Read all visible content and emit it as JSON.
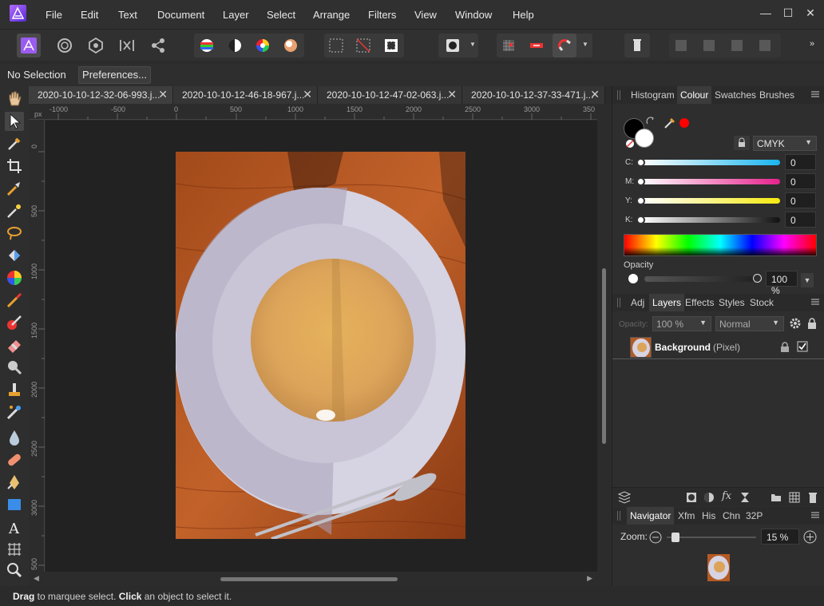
{
  "menu": {
    "items": [
      "File",
      "Edit",
      "Text",
      "Document",
      "Layer",
      "Select",
      "Arrange",
      "Filters",
      "View",
      "Window",
      "Help"
    ]
  },
  "window_controls": {
    "minimize": "—",
    "maximize": "☐",
    "close": "✕"
  },
  "toolbar": {
    "personas": [
      "photo-persona",
      "liquify-persona",
      "develop-persona",
      "tone-mapping-persona",
      "export-persona"
    ]
  },
  "context": {
    "selection_label": "No Selection",
    "preferences_label": "Preferences..."
  },
  "document_tabs": [
    {
      "label": "2020-10-10-12-32-06-993.j...",
      "close": "✕"
    },
    {
      "label": "2020-10-10-12-46-18-967.j...",
      "close": "✕"
    },
    {
      "label": "2020-10-10-12-47-02-063.j...",
      "close": "✕"
    },
    {
      "label": "2020-10-10-12-37-33-471.j...",
      "close": "✕"
    }
  ],
  "rulers": {
    "unit": "px",
    "top": [
      "-1000",
      "-500",
      "0",
      "500",
      "1000",
      "1500",
      "2000",
      "2500",
      "3000",
      "350"
    ],
    "left": [
      "0",
      "500",
      "1000",
      "1500",
      "2000",
      "2500",
      "3000",
      "500"
    ]
  },
  "colour_panel": {
    "tabs": [
      "Histogram",
      "Colour",
      "Swatches",
      "Brushes"
    ],
    "active_tab": "Colour",
    "model": "CMYK",
    "sliders": [
      {
        "label": "C:",
        "value": "0"
      },
      {
        "label": "M:",
        "value": "0"
      },
      {
        "label": "Y:",
        "value": "0"
      },
      {
        "label": "K:",
        "value": "0"
      }
    ],
    "opacity_label": "Opacity",
    "opacity_value": "100 %",
    "colors": {
      "primary": "#000000",
      "secondary": "#ffffff",
      "picked": "#ff0000"
    }
  },
  "layers_panel": {
    "tabs": [
      "Adj",
      "Layers",
      "Effects",
      "Styles",
      "Stock"
    ],
    "active_tab": "Layers",
    "opacity_label": "Opacity:",
    "opacity_value": "100 %",
    "blend_mode": "Normal",
    "layers": [
      {
        "name": "Background",
        "type": "(Pixel)",
        "visible": true
      }
    ]
  },
  "navigator_panel": {
    "tabs": [
      "Navigator",
      "Xfm",
      "His",
      "Chn",
      "32P"
    ],
    "active_tab": "Navigator",
    "zoom_label": "Zoom:",
    "zoom_value": "15 %"
  },
  "status": {
    "drag": "Drag",
    "drag_text": " to marquee select. ",
    "click": "Click",
    "click_text": " an object to select it."
  }
}
